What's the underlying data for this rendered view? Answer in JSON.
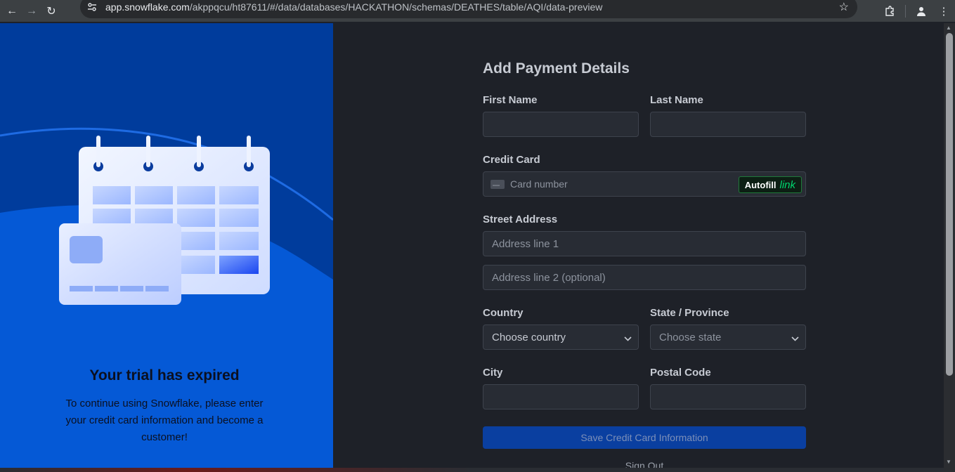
{
  "browser": {
    "url_host": "app.snowflake.com",
    "url_path": "/akppqcu/ht87611/#/data/databases/HACKATHON/schemas/DEATHES/table/AQI/data-preview"
  },
  "left": {
    "title": "Your trial has expired",
    "message": "To continue using Snowflake, please enter your credit card information and become a customer!"
  },
  "form": {
    "title": "Add Payment Details",
    "first_name_label": "First Name",
    "last_name_label": "Last Name",
    "credit_card_label": "Credit Card",
    "card_number_placeholder": "Card number",
    "autofill_label": "Autofill",
    "autofill_link": "link",
    "street_label": "Street Address",
    "address1_placeholder": "Address line 1",
    "address2_placeholder": "Address line 2 (optional)",
    "country_label": "Country",
    "country_value": "Choose country",
    "state_label": "State / Province",
    "state_value": "Choose state",
    "city_label": "City",
    "postal_label": "Postal Code",
    "save_button": "Save Credit Card Information",
    "sign_out": "Sign Out"
  },
  "colors": {
    "left_bg": "#0559d6",
    "right_bg": "#1e2128",
    "save_button_bg": "#0a3fa0",
    "link_green": "#00d66f"
  }
}
